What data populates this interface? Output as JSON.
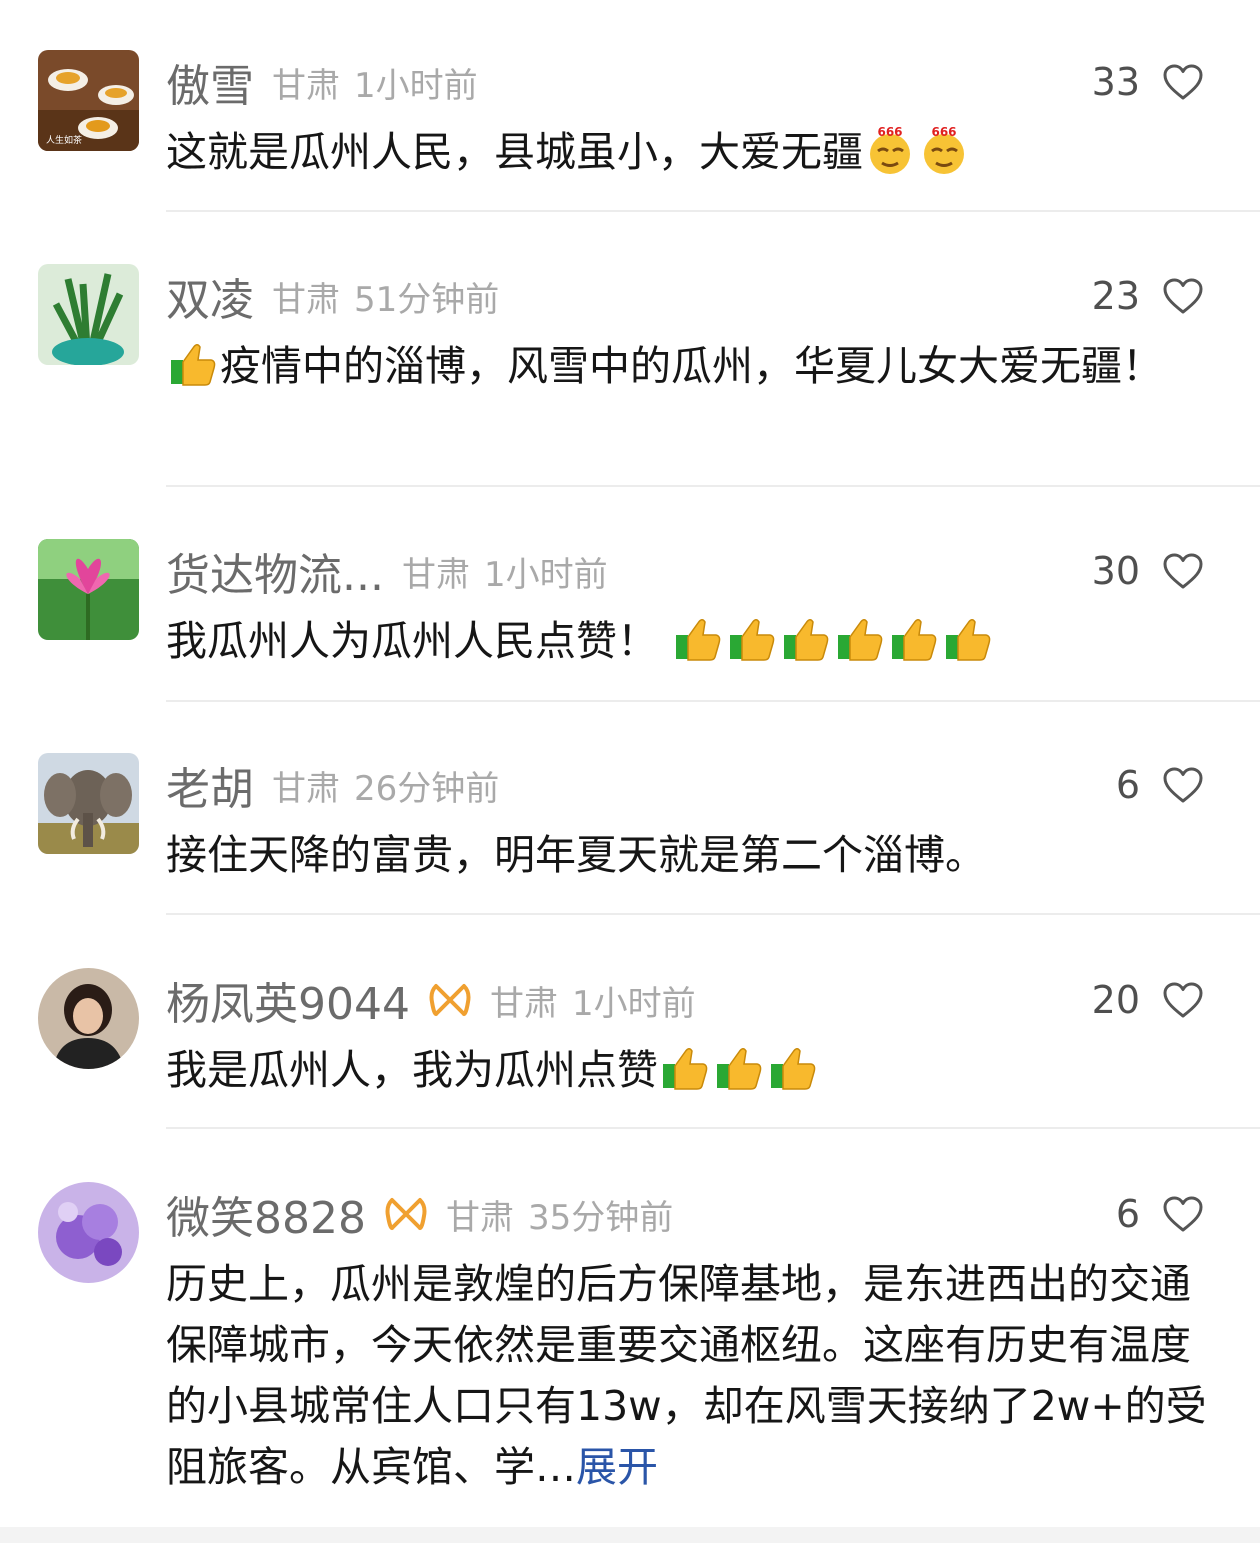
{
  "comments": [
    {
      "name": "傲雪",
      "location": "甘肃",
      "time": "1小时前",
      "likes": "33",
      "text": "这就是瓜州人民，县城虽小，大爱无疆",
      "avatar_caption": "人生如茶",
      "emoji_label": "666"
    },
    {
      "name": "双凌",
      "location": "甘肃",
      "time": "51分钟前",
      "likes": "23",
      "text": "疫情中的淄博，风雪中的瓜州，华夏儿女大爱无疆！"
    },
    {
      "name": "货达物流...",
      "location": "甘肃",
      "time": "1小时前",
      "likes": "30",
      "text": "我瓜州人为瓜州人民点赞！"
    },
    {
      "name": "老胡",
      "location": "甘肃",
      "time": "26分钟前",
      "likes": "6",
      "text": "接住天降的富贵，明年夏天就是第二个淄博。"
    },
    {
      "name": "杨凤英9044",
      "location": "甘肃",
      "time": "1小时前",
      "likes": "20",
      "text": "我是瓜州人，我为瓜州点赞"
    },
    {
      "name": "微笑8828",
      "location": "甘肃",
      "time": "35分钟前",
      "likes": "6",
      "text": "历史上，瓜州是敦煌的后方保障基地，是东进西出的交通保障城市，今天依然是重要交通枢纽。这座有历史有温度的小县城常住人口只有13w，却在风雪天接纳了2w+的受阻旅客。从宾馆、学…",
      "expand_label": "展开"
    }
  ],
  "colors": {
    "name": "#6b6b6b",
    "meta": "#a9a9a9",
    "text": "#161616",
    "link": "#2a55a8",
    "badge": "#f0a030",
    "divider": "#ececec"
  },
  "icons": {
    "like": "heart-outline-icon",
    "badge": "infinity-badge-icon",
    "thumbs": "thumbs-up-emoji",
    "emoji666": "666-emoji"
  }
}
